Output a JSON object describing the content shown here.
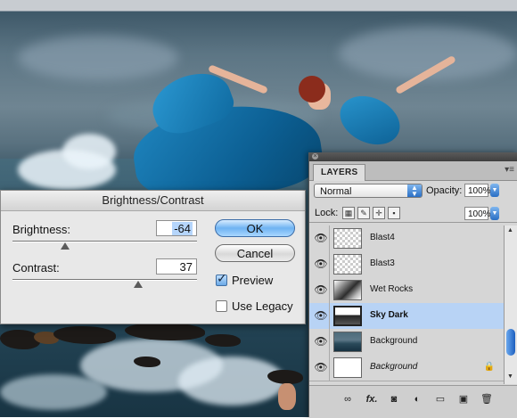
{
  "brightness_contrast_dialog": {
    "title": "Brightness/Contrast",
    "brightness_label": "Brightness:",
    "brightness_value": "-64",
    "brightness_slider_fraction": 0.27,
    "contrast_label": "Contrast:",
    "contrast_value": "37",
    "contrast_slider_fraction": 0.65,
    "ok_label": "OK",
    "cancel_label": "Cancel",
    "preview_label": "Preview",
    "preview_checked": true,
    "use_legacy_label": "Use Legacy",
    "use_legacy_checked": false
  },
  "layers_panel": {
    "tab_label": "LAYERS",
    "blend_mode": "Normal",
    "opacity_label": "Opacity:",
    "opacity_value": "100%",
    "lock_label": "Lock:",
    "fill_value": "100%",
    "layers": [
      {
        "name": "Blast4",
        "visible": true,
        "selected": false,
        "thumb": "transparent"
      },
      {
        "name": "Blast3",
        "visible": true,
        "selected": false,
        "thumb": "transparent"
      },
      {
        "name": "Wet Rocks",
        "visible": true,
        "selected": false,
        "thumb": "rocks"
      },
      {
        "name": "Sky Dark",
        "visible": true,
        "selected": true,
        "thumb": "sky"
      },
      {
        "name": "Background",
        "visible": true,
        "selected": false,
        "thumb": "photo"
      },
      {
        "name": "Background",
        "visible": true,
        "selected": false,
        "thumb": "plain",
        "italic": true,
        "locked": true
      }
    ]
  },
  "icons": {
    "eye": "👁",
    "lock": "🔒",
    "link": "∞",
    "fx": "fx.",
    "mask": "◙",
    "adjustment": "◐",
    "folder": "▭",
    "new_layer": "▣",
    "trash": "🗑"
  },
  "colors": {
    "selected_layer": "#b8d3f5",
    "default_button": "#6fb3f2",
    "dress_blue": "#1f86c0"
  }
}
